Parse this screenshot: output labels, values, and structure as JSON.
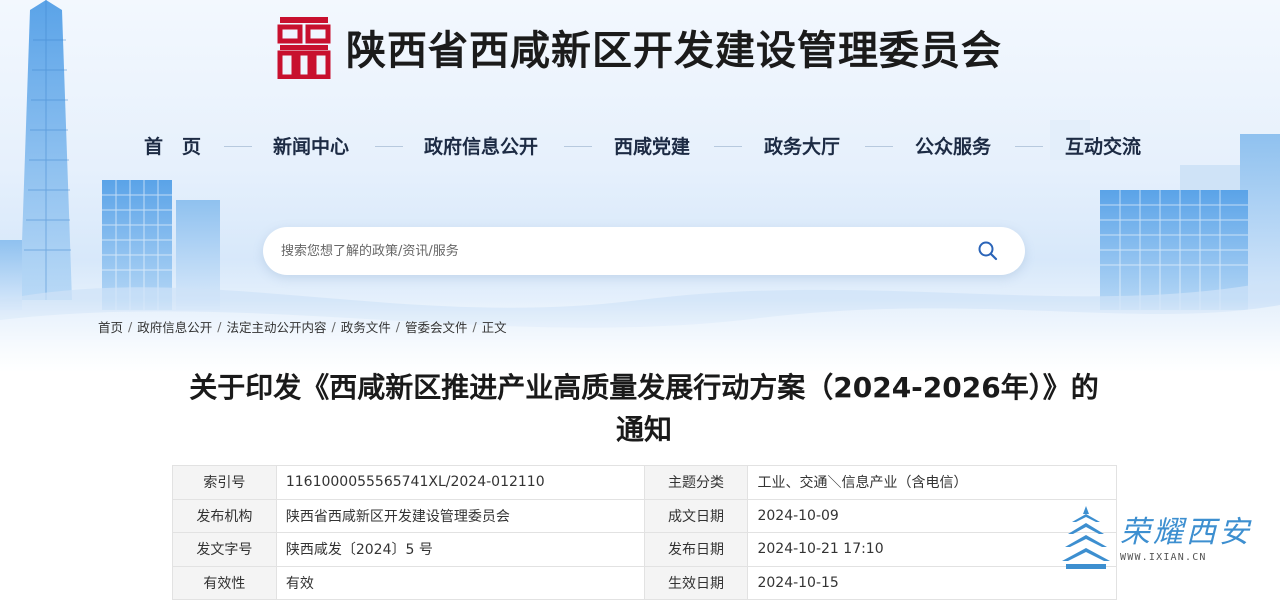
{
  "site": {
    "title": "陕西省西咸新区开发建设管理委员会",
    "brand_color": "#c8102e"
  },
  "nav": {
    "items": [
      {
        "label": "首　页"
      },
      {
        "label": "新闻中心"
      },
      {
        "label": "政府信息公开"
      },
      {
        "label": "西咸党建"
      },
      {
        "label": "政务大厅"
      },
      {
        "label": "公众服务"
      },
      {
        "label": "互动交流"
      }
    ]
  },
  "search": {
    "placeholder": "搜索您想了解的政策/资讯/服务",
    "icon": "search-icon"
  },
  "breadcrumb": {
    "items": [
      "首页",
      "政府信息公开",
      "法定主动公开内容",
      "政务文件",
      "管委会文件",
      "正文"
    ],
    "separator": "/"
  },
  "article": {
    "title_line1": "关于印发《西咸新区推进产业高质量发展行动方案（2024-2026年）》的",
    "title_line2": "通知"
  },
  "meta": {
    "rows": [
      {
        "k1": "索引号",
        "v1": "1161000055565741XL/2024-012110",
        "k2": "主题分类",
        "v2": "工业、交通＼信息产业（含电信）"
      },
      {
        "k1": "发布机构",
        "v1": "陕西省西咸新区开发建设管理委员会",
        "k2": "成文日期",
        "v2": "2024-10-09"
      },
      {
        "k1": "发文字号",
        "v1": "陕西咸发〔2024〕5 号",
        "k2": "发布日期",
        "v2": "2024-10-21 17:10"
      },
      {
        "k1": "有效性",
        "v1": "有效",
        "k2": "生效日期",
        "v2": "2024-10-15"
      }
    ]
  },
  "watermark": {
    "text": "荣耀西安",
    "url": "WWW.IXIAN.CN",
    "color": "#3d8fd0"
  }
}
